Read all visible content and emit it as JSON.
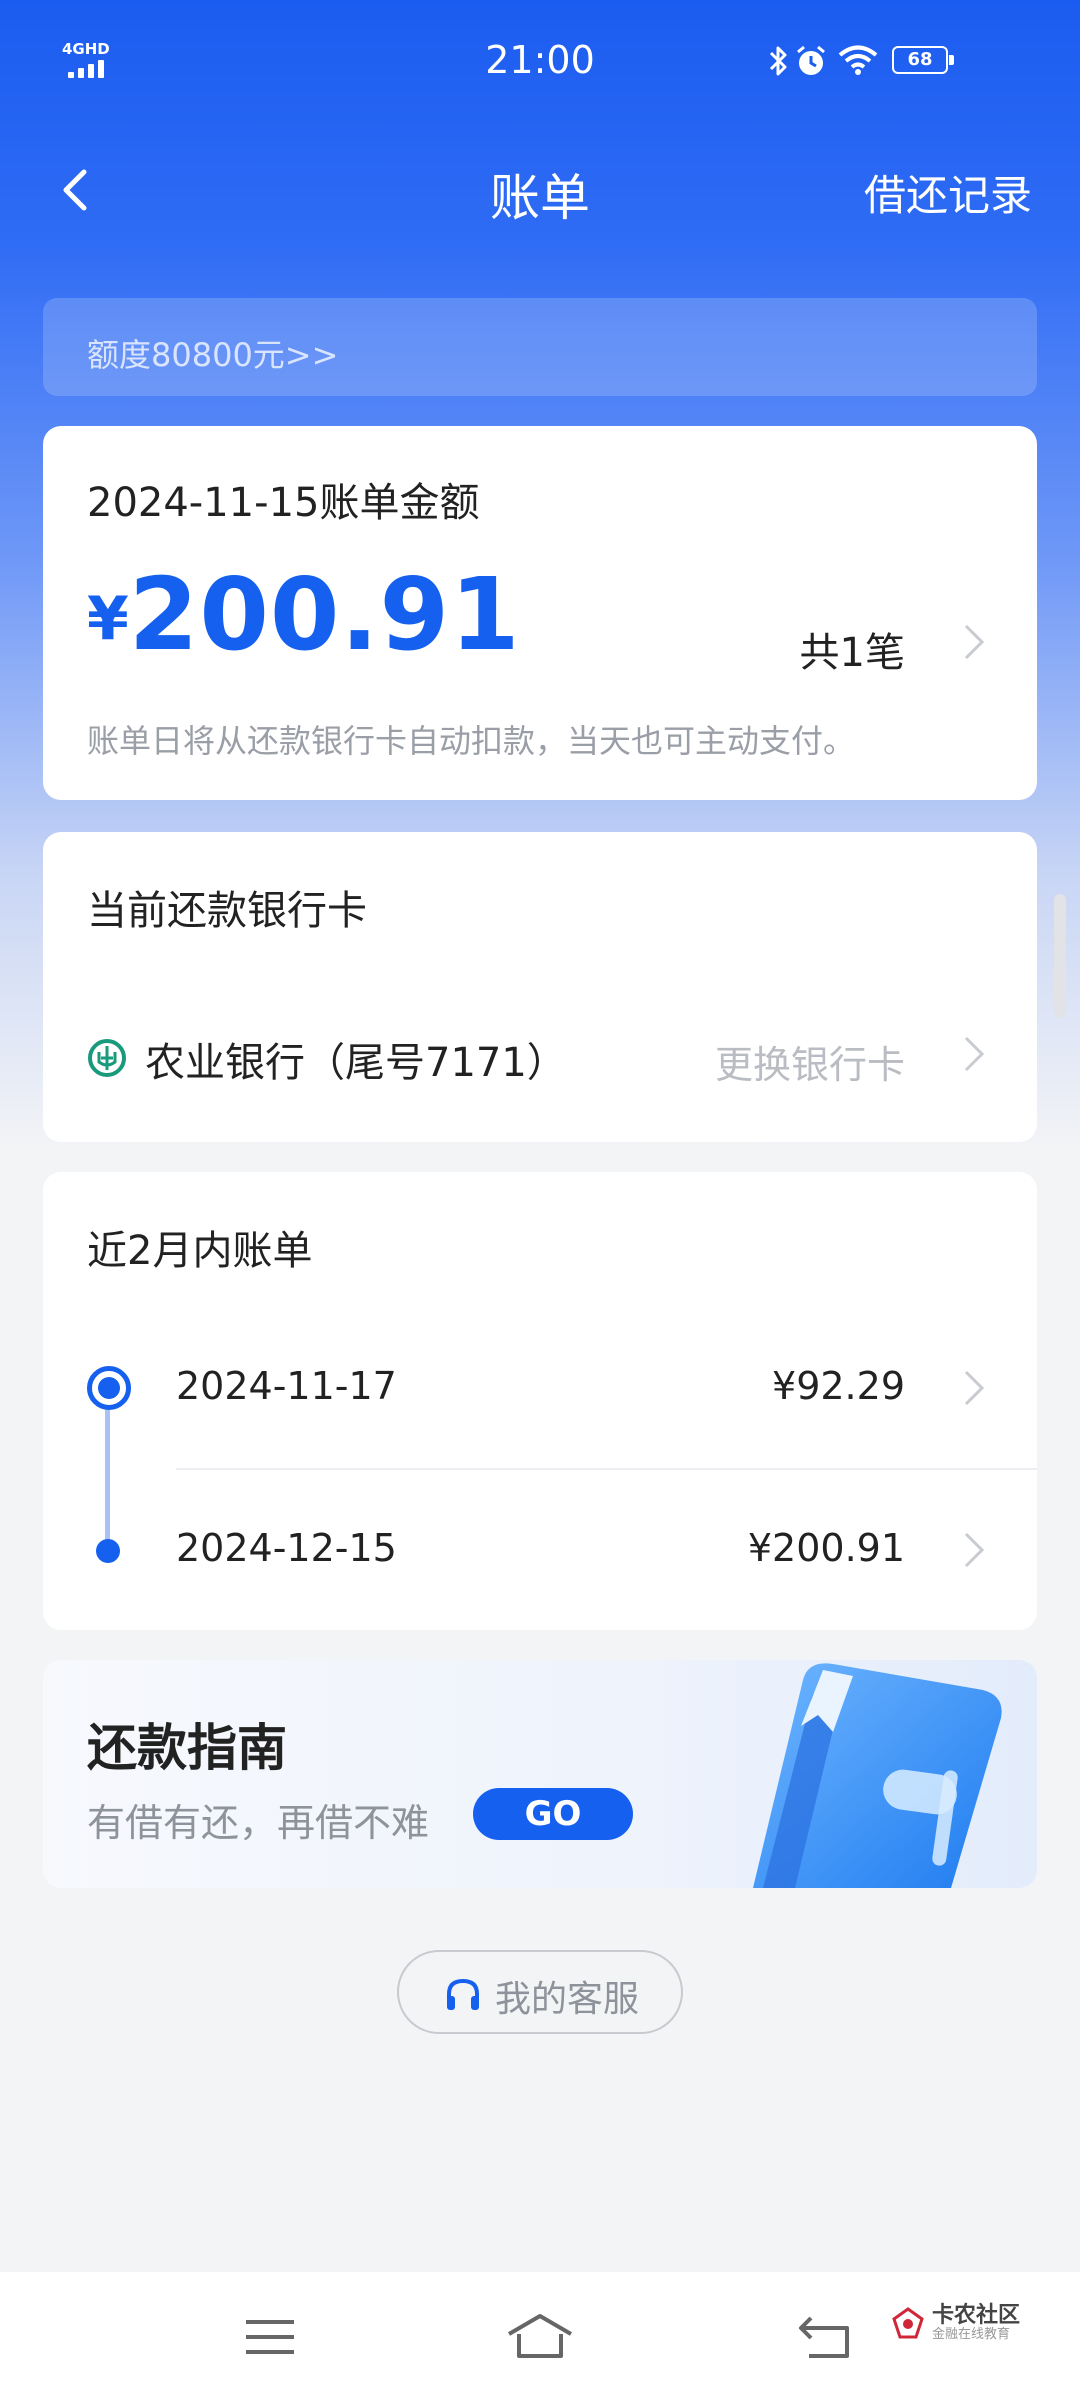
{
  "status_bar": {
    "network": "4GHD",
    "time": "21:00",
    "battery": "68",
    "icons": [
      "bluetooth-icon",
      "alarm-icon",
      "wifi-icon",
      "battery-icon"
    ]
  },
  "nav": {
    "title": "账单",
    "right_link": "借还记录",
    "back_icon": "chevron-left-icon"
  },
  "quota": {
    "text": "额度80800元>>"
  },
  "bill": {
    "date_title": "2024-11-15账单金额",
    "currency": "¥",
    "amount": "200.91",
    "count": "共1笔",
    "note": "账单日将从还款银行卡自动扣款，当天也可主动支付。"
  },
  "bank": {
    "heading": "当前还款银行卡",
    "bank_name": "农业银行（尾号7171）",
    "change_label": "更换银行卡",
    "logo_color": "#1a9a7c"
  },
  "history": {
    "heading": "近2月内账单",
    "rows": [
      {
        "date": "2024-11-17",
        "amount": "¥92.29"
      },
      {
        "date": "2024-12-15",
        "amount": "¥200.91"
      }
    ]
  },
  "guide": {
    "title": "还款指南",
    "subtitle": "有借有还，再借不难",
    "go_label": "GO"
  },
  "service": {
    "label": "我的客服",
    "icon": "headset-icon"
  },
  "bottom_nav": {
    "items": [
      "menu-icon",
      "home-icon",
      "back-icon"
    ]
  },
  "watermark": {
    "main": "卡农社区",
    "sub": "金融在线教育"
  },
  "colors": {
    "accent": "#1560ef",
    "header_gradient_top": "#1b5cf0",
    "page_bg": "#f3f4f6"
  }
}
